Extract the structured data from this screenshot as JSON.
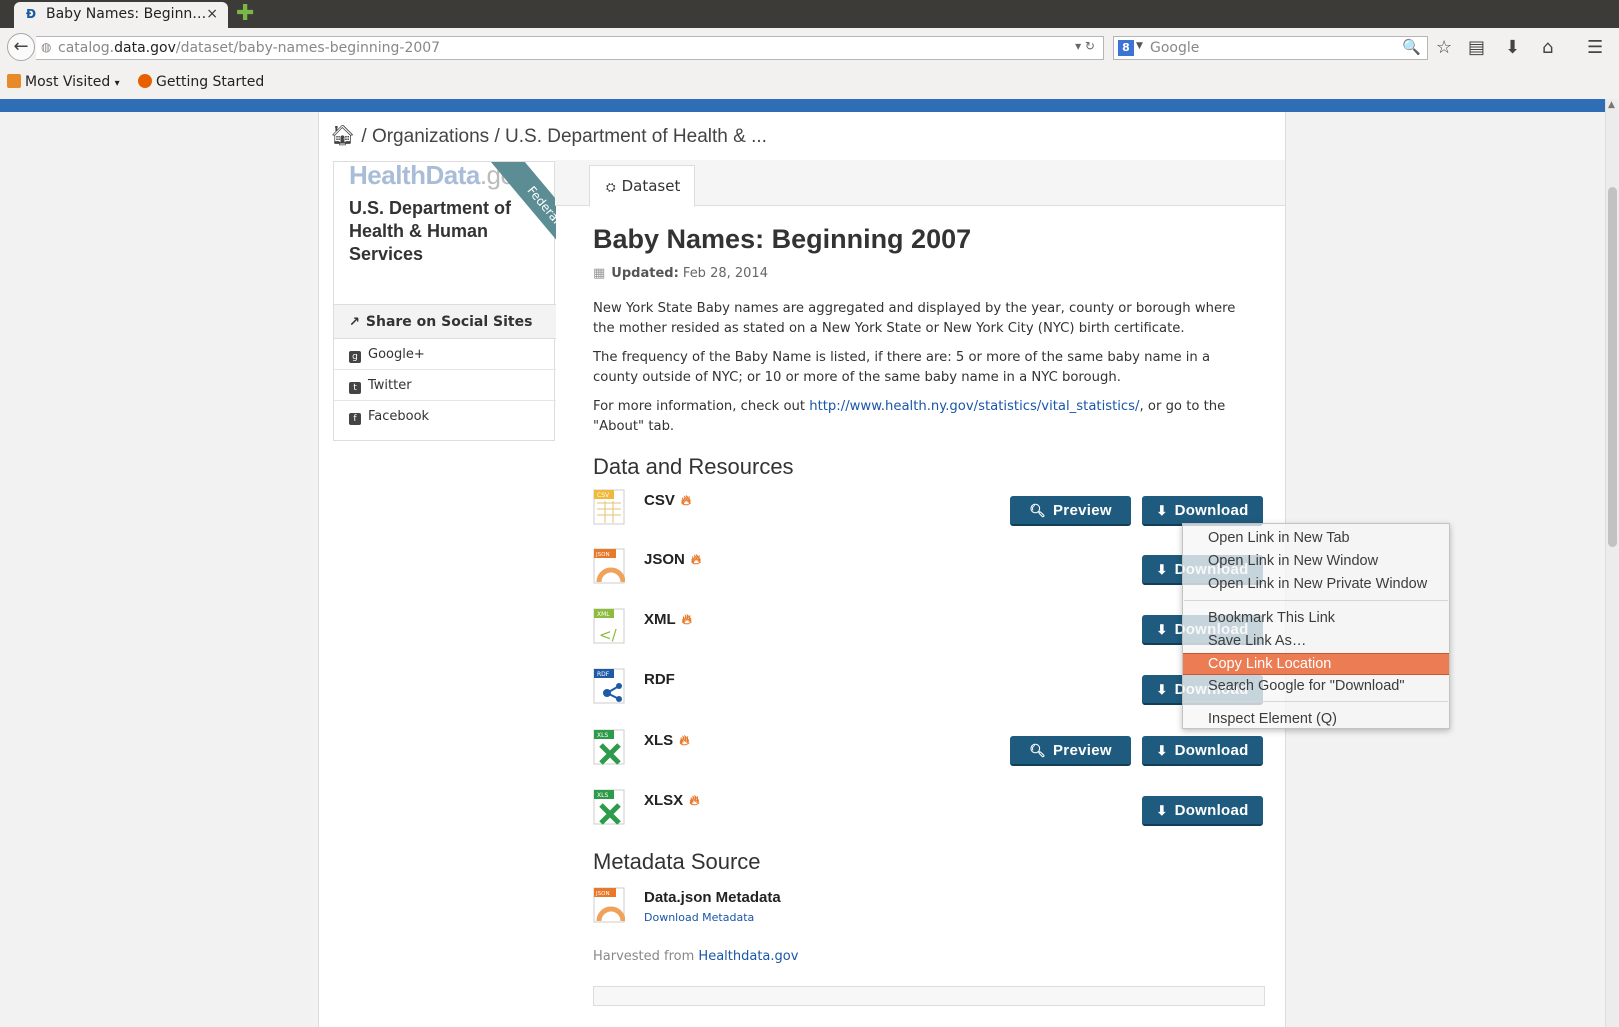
{
  "browser": {
    "tab_title": "Baby Names: Beginn…",
    "tab_close": "×",
    "new_tab": "✚",
    "url_prefix": "catalog.",
    "url_host": "data.gov",
    "url_path": "/dataset/baby-names-beginning-2007",
    "search_placeholder": "Google",
    "bookmarks": [
      "Most Visited",
      "Getting Started"
    ]
  },
  "breadcrumb": {
    "separator1": "/",
    "item1": "Organizations",
    "separator2": "/",
    "item2": "U.S. Department of Health & ..."
  },
  "sidebar": {
    "logo_text": "HealthData",
    "logo_suffix": ".gov",
    "ribbon": "Federal",
    "org_name": "U.S. Department of Health & Human Services",
    "share_heading": "Share on Social Sites",
    "share_items": [
      "Google+",
      "Twitter",
      "Facebook"
    ]
  },
  "tabs": [
    "Dataset"
  ],
  "dataset": {
    "title": "Baby Names: Beginning 2007",
    "updated_label": "Updated:",
    "updated_date": "Feb 28, 2014",
    "paragraph1": "New York State Baby names are aggregated and displayed by the year, county or borough where the mother resided as stated on a New York State or New York City (NYC) birth certificate.",
    "paragraph2": "The frequency of the Baby Name is listed, if there are: 5 or more of the same baby name in a county outside of NYC; or 10 or more of the same baby name in a NYC borough.",
    "paragraph3_before": "For more information, check out ",
    "paragraph3_link": "http://www.health.ny.gov/statistics/vital_statistics/",
    "paragraph3_after": ", or go to the \"About\" tab."
  },
  "resources": {
    "heading": "Data and Resources",
    "preview_label": "Preview",
    "download_label": "Download",
    "items": [
      {
        "name": "CSV",
        "tag": "CSV",
        "color": "#f0b93a"
      },
      {
        "name": "JSON",
        "tag": "JSON",
        "color": "#e8782a"
      },
      {
        "name": "XML",
        "tag": "XML",
        "color": "#8dbb3c"
      },
      {
        "name": "RDF",
        "tag": "RDF",
        "color": "#1f5aa6"
      },
      {
        "name": "XLS",
        "tag": "XLS",
        "color": "#2e9b4a"
      },
      {
        "name": "XLSX",
        "tag": "XLS",
        "color": "#2e9b4a"
      }
    ]
  },
  "metadata": {
    "heading": "Metadata Source",
    "name": "Data.json Metadata",
    "link": "Download Metadata",
    "harvested_label": "Harvested from ",
    "harvested_link": "Healthdata.gov"
  },
  "context_menu": {
    "items": [
      "Open Link in New Tab",
      "Open Link in New Window",
      "Open Link in New Private Window",
      "Bookmark This Link",
      "Save Link As…",
      "Copy Link Location",
      "Search Google for \"Download\"",
      "Inspect Element (Q)"
    ],
    "active": "Copy Link Location"
  },
  "colors": {
    "brand_blue": "#2f6db5",
    "button": "#1e5b7e",
    "menu_highlight": "#e97144",
    "flame": "#e8782a"
  }
}
